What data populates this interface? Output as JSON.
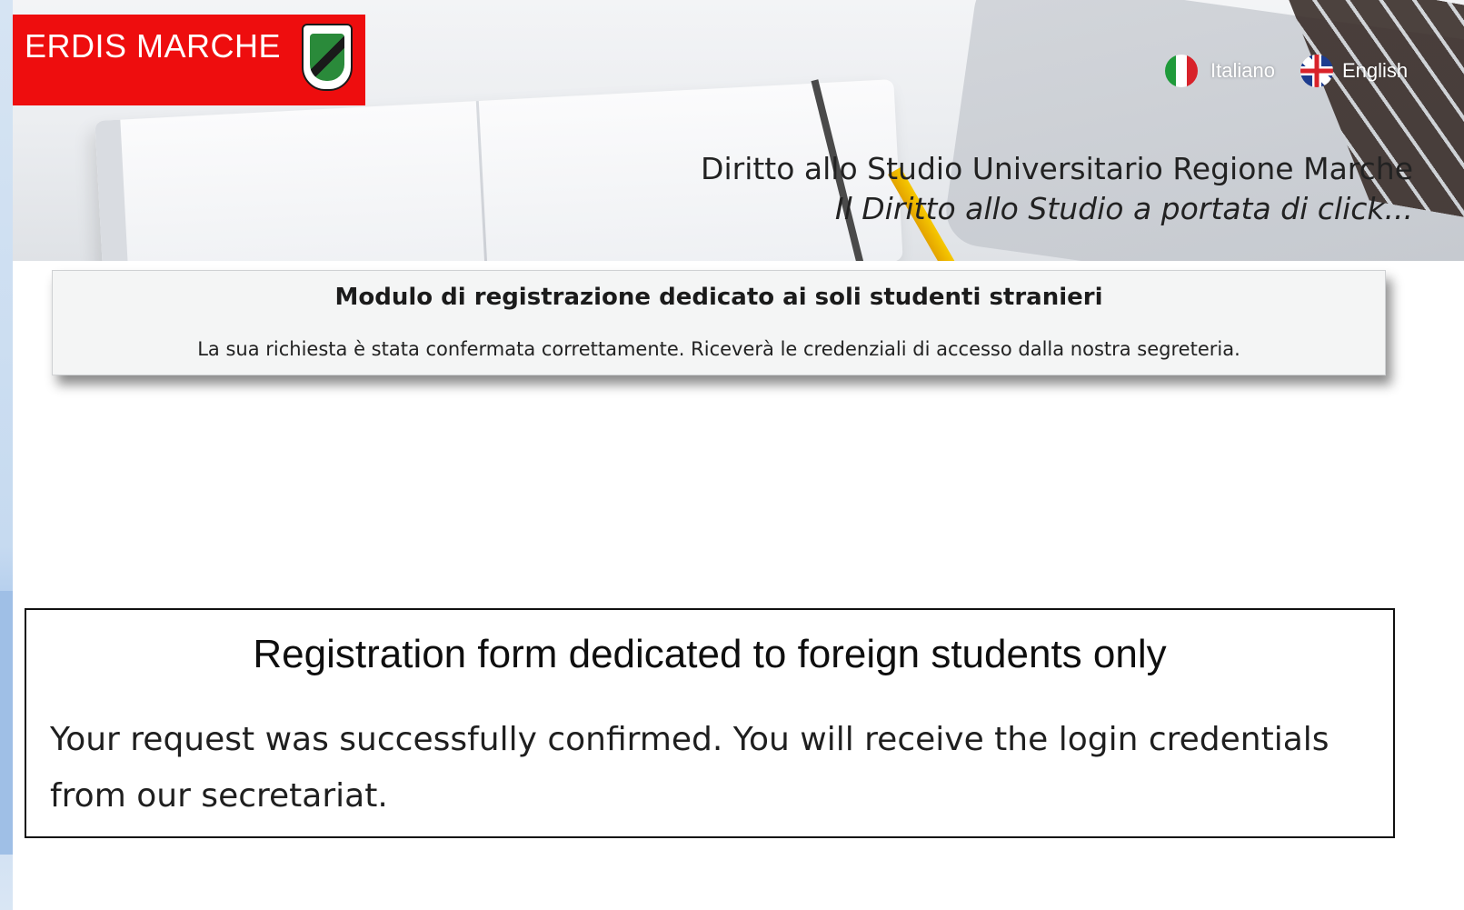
{
  "header": {
    "logo_text": "ERDIS MARCHE",
    "brand_color": "#ee0d0e",
    "languages": [
      {
        "label": "Italiano",
        "icon": "italy-flag-icon"
      },
      {
        "label": "English",
        "icon": "uk-flag-icon"
      }
    ],
    "tagline": "Diritto allo Studio Universitario Regione Marche",
    "subtagline": "Il Diritto allo Studio a portata di click..."
  },
  "italian_notice": {
    "title": "Modulo di registrazione dedicato ai soli studenti stranieri",
    "message": "La sua richiesta è stata confermata correttamente. Riceverà le credenziali di accesso dalla nostra segreteria."
  },
  "english_notice": {
    "title": "Registration form dedicated to foreign students only",
    "message": "Your request was successfully confirmed. You will receive the login credentials from our secretariat."
  }
}
